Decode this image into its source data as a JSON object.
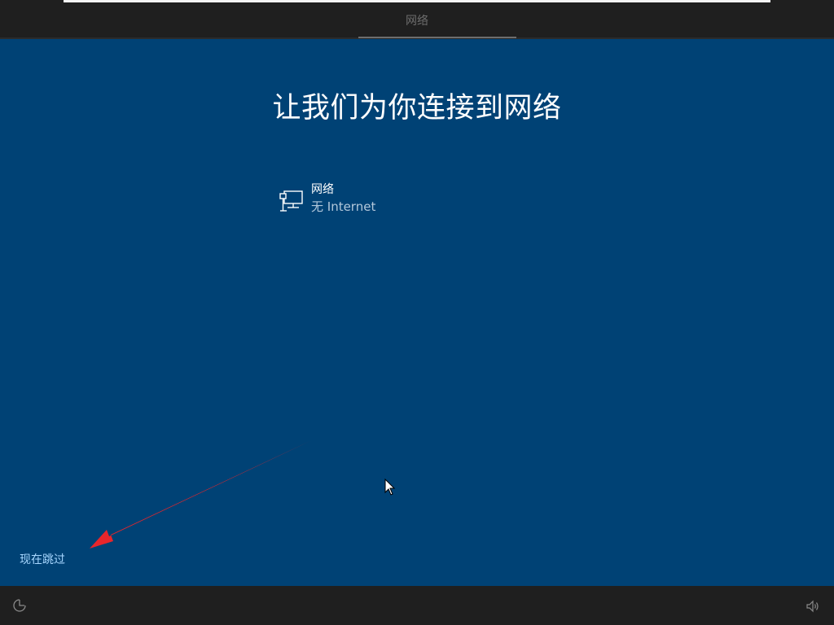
{
  "header": {
    "step_label": "网络"
  },
  "main": {
    "title": "让我们为你连接到网络",
    "network": {
      "icon": "wired-network-icon",
      "name": "网络",
      "status": "无 Internet"
    },
    "skip_label": "现在跳过"
  },
  "footer": {
    "left_icon": "ease-of-access-icon",
    "right_icon": "volume-icon"
  },
  "colors": {
    "main_bg": "#004275",
    "bar_bg": "#1f1f1f",
    "link": "#a7d7ff",
    "annotation_arrow": "#e8262b"
  }
}
